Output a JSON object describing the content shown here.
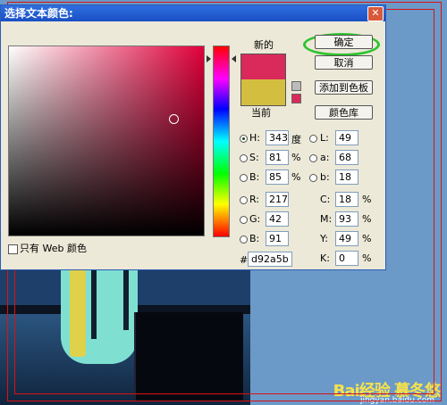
{
  "dialog": {
    "title": "选择文本颜色:",
    "close_glyph": "✕",
    "web_only_label": "只有 Web 颜色",
    "new_label": "新的",
    "current_label": "当前",
    "buttons": {
      "ok": "确定",
      "cancel": "取消",
      "add_swatch": "添加到色板",
      "libraries": "颜色库"
    },
    "hsb": [
      {
        "label": "H:",
        "value": "343",
        "unit": "度"
      },
      {
        "label": "S:",
        "value": "81",
        "unit": "%"
      },
      {
        "label": "B:",
        "value": "85",
        "unit": "%"
      }
    ],
    "rgb": [
      {
        "label": "R:",
        "value": "217"
      },
      {
        "label": "G:",
        "value": "42"
      },
      {
        "label": "B:",
        "value": "91"
      }
    ],
    "lab": [
      {
        "label": "L:",
        "value": "49"
      },
      {
        "label": "a:",
        "value": "68"
      },
      {
        "label": "b:",
        "value": "18"
      }
    ],
    "cmyk": [
      {
        "label": "C:",
        "value": "18",
        "unit": "%"
      },
      {
        "label": "M:",
        "value": "93",
        "unit": "%"
      },
      {
        "label": "Y:",
        "value": "49",
        "unit": "%"
      },
      {
        "label": "K:",
        "value": "0",
        "unit": "%"
      }
    ],
    "hex_label": "#",
    "hex_value": "d92a5b",
    "colors": {
      "new": "#d92a5b",
      "current": "#d4be40",
      "titlebar": "#1a4fc4",
      "highlight_ring": "#2ec32e"
    }
  },
  "watermark": {
    "brand": "Bai经验",
    "url": "jingyan.baidu.com",
    "author": "慕冬悠"
  }
}
